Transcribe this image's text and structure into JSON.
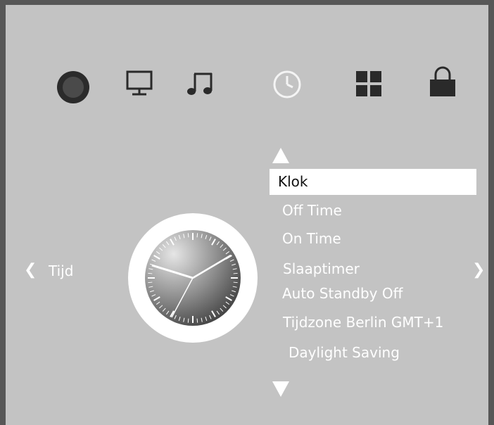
{
  "top_icons": [
    {
      "icon": "record-icon"
    },
    {
      "icon": "monitor-icon"
    },
    {
      "icon": "music-note-icon"
    },
    {
      "icon": "clock-icon"
    },
    {
      "icon": "grid-apps-icon"
    },
    {
      "icon": "lock-icon"
    }
  ],
  "nav": {
    "left_label": "Tijd",
    "left_chevron": "❮",
    "right_chevron": "❯"
  },
  "menu": {
    "items": [
      {
        "label": "Klok",
        "selected": true
      },
      {
        "label": "Off Time"
      },
      {
        "label": "On Time"
      },
      {
        "label": "Slaaptimer"
      },
      {
        "label": "Auto Standby Off"
      },
      {
        "label": "Tijdzone Berlin GMT+1"
      },
      {
        "label": "Daylight Saving"
      }
    ]
  },
  "colors": {
    "background": "#c3c3c3",
    "frame": "#575757",
    "icon": "#2a2a2a",
    "accent": "#ffffff"
  }
}
